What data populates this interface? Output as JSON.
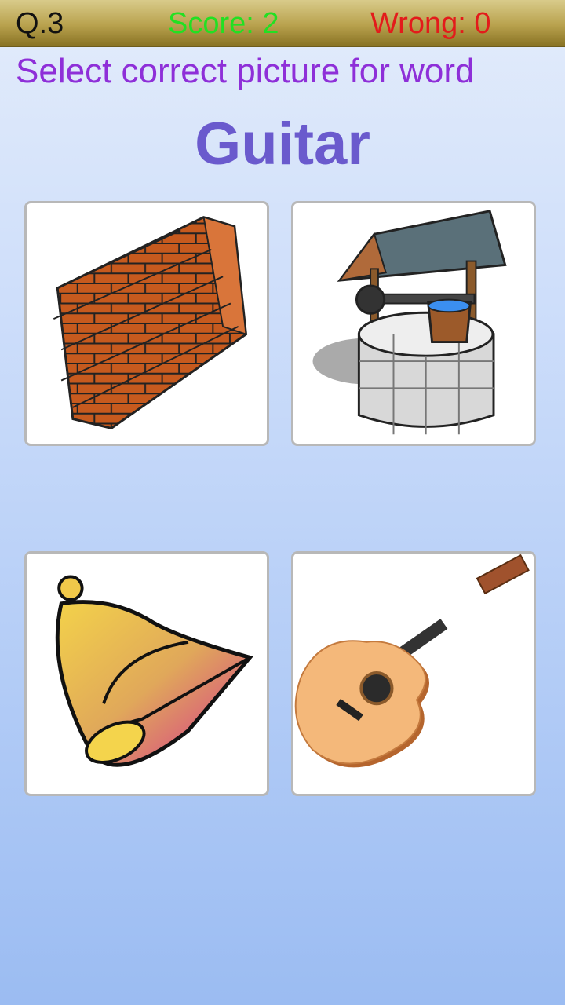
{
  "header": {
    "question": "Q.3",
    "score": "Score: 2",
    "wrong": "Wrong: 0"
  },
  "instruction": "Select correct picture for word",
  "word": "Guitar",
  "options": [
    {
      "picture": "brick-wall"
    },
    {
      "picture": "wishing-well"
    },
    {
      "picture": "bell"
    },
    {
      "picture": "guitar"
    }
  ]
}
